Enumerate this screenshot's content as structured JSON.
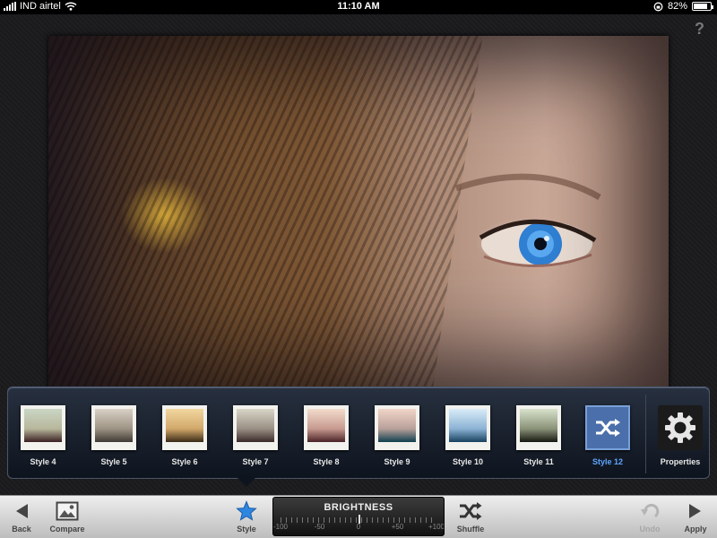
{
  "status_bar": {
    "carrier": "IND airtel",
    "time": "11:10 AM",
    "battery": "82%",
    "battery_level": 0.82
  },
  "help_label": "?",
  "styles": {
    "items": [
      {
        "label": "Style 4",
        "top": "#c9d6c4",
        "mid": "#b8b79c",
        "bottom": "#3a1f22"
      },
      {
        "label": "Style 5",
        "top": "#d9d1c6",
        "mid": "#9d9384",
        "bottom": "#3f3a35"
      },
      {
        "label": "Style 6",
        "top": "#f2d7a0",
        "mid": "#d1a86a",
        "bottom": "#3b2a17"
      },
      {
        "label": "Style 7",
        "top": "#d9d6c8",
        "mid": "#9a8f84",
        "bottom": "#3a2a2a"
      },
      {
        "label": "Style 8",
        "top": "#f3dccd",
        "mid": "#c79a8f",
        "bottom": "#4a2227"
      },
      {
        "label": "Style 9",
        "top": "#f1d5c8",
        "mid": "#b8a09a",
        "bottom": "#0f3f4f"
      },
      {
        "label": "Style 10",
        "top": "#d9ecf8",
        "mid": "#8cb2d4",
        "bottom": "#17415f"
      },
      {
        "label": "Style 11",
        "top": "#d8e2cc",
        "mid": "#8a9278",
        "bottom": "#141810"
      },
      {
        "label": "Style 12",
        "selected": true,
        "icon": "shuffle-icon"
      }
    ]
  },
  "properties": {
    "label": "Properties",
    "icon": "gear-icon"
  },
  "toolbar": {
    "back": {
      "label": "Back",
      "icon": "back-arrow-icon"
    },
    "compare": {
      "label": "Compare",
      "icon": "image-icon"
    },
    "style": {
      "label": "Style",
      "icon": "star-icon"
    },
    "slider": {
      "title": "BRIGHTNESS",
      "ticks": [
        "-100",
        "-50",
        "0",
        "+50",
        "+100"
      ],
      "value": 0
    },
    "shuffle": {
      "label": "Shuffle",
      "icon": "shuffle-icon"
    },
    "undo": {
      "label": "Undo",
      "icon": "undo-icon",
      "enabled": false
    },
    "apply": {
      "label": "Apply",
      "icon": "forward-arrow-icon"
    }
  },
  "colors": {
    "accent": "#5ea5ff",
    "selected_style_bg": "#4a6faa"
  }
}
